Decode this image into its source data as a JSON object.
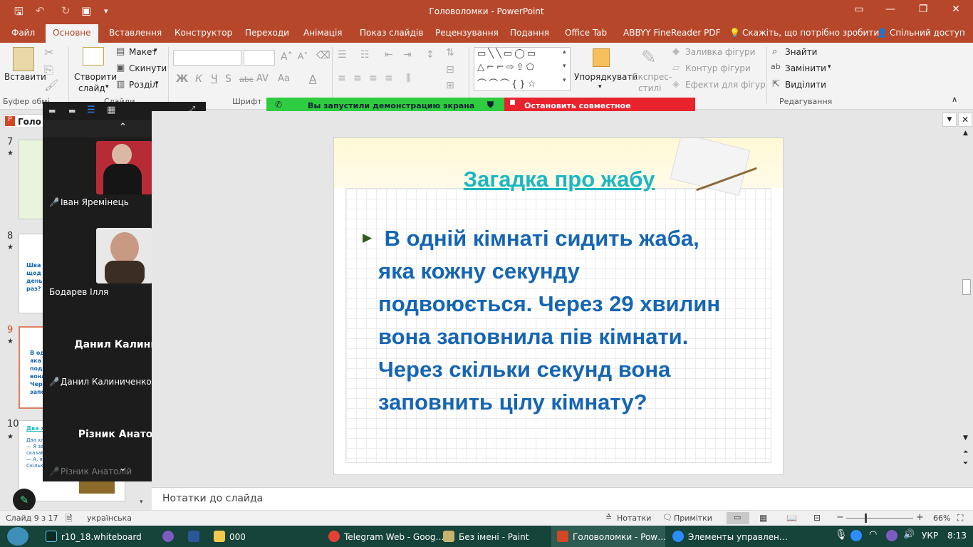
{
  "window": {
    "title": "Головоломки - PowerPoint"
  },
  "tabs": [
    "Файл",
    "Основне",
    "Вставлення",
    "Конструктор",
    "Переходи",
    "Анімація",
    "Показ слайдів",
    "Рецензування",
    "Подання",
    "Office Tab",
    "ABBYY FineReader PDF"
  ],
  "tell_me": "Скажіть, що потрібно зробити",
  "share": "Спільний доступ",
  "ribbon": {
    "paste": "Вставити",
    "new_slide_line1": "Створити",
    "new_slide_line2": "слайд",
    "layout": "Макет",
    "reset": "Скинути",
    "section": "Розділ",
    "clipboard_group": "Буфер обмі…",
    "slides_group": "Слайди",
    "font_group": "Шрифт",
    "arrange": "Упорядкувати",
    "express_line1": "Експрес-",
    "express_line2": "стилі",
    "shape_fill": "Заливка фігури",
    "shape_outline": "Контур фігури",
    "shape_effects": "Ефекти для фігур",
    "find": "Знайти",
    "replace": "Замінити",
    "select": "Виділити",
    "editing_group": "Редагування"
  },
  "screen_share": {
    "notice": "Вы запустили демонстрацию экрана",
    "stop": "Остановить совместное использование"
  },
  "thumbnails": [
    {
      "num": "7"
    },
    {
      "num": "8",
      "lines": [
        "Шва",
        "щод",
        "день",
        "раз?"
      ]
    },
    {
      "num": "9",
      "lines": [
        "В од",
        "яка",
        "поді",
        "вона",
        "Черє",
        "запо"
      ]
    },
    {
      "num": "10",
      "title": "Два х",
      "lines": [
        "Два хлоп",
        "— Я зав",
        "сказав В",
        "— А, я -",
        "Скільки"
      ]
    }
  ],
  "left_tab_label": "Голо",
  "zoom_panel": {
    "participants": [
      {
        "name": "Іван Яремінець",
        "muted": true,
        "has_video": true
      },
      {
        "name": "Бодарев Ілля",
        "muted": false,
        "has_video": true
      },
      {
        "name": "Данил Калиниченко.",
        "display": "Данил  Калинич…",
        "muted": true,
        "has_video": false
      },
      {
        "name": "Різник Анатолій",
        "display": "Різник Анатолій",
        "muted": true,
        "has_video": false
      }
    ]
  },
  "slide": {
    "title": "Загадка про жабу",
    "body_lines": [
      " В одній кімнаті сидить жаба,",
      "яка кожну секунду",
      "подвоюється. Через 29 хвилин",
      "вона заповнила пів кімнати.",
      "Через скільки секунд вона",
      "заповнить цілу кімнату?"
    ],
    "title_color": "#1ab7c2",
    "text_color": "#1565b4"
  },
  "notes_placeholder": "Нотатки до слайда",
  "status": {
    "slide_of": "Слайд 9 з 17",
    "language": "українська",
    "notes": "Нотатки",
    "comments": "Примітки",
    "zoom": "66%"
  },
  "taskbar": {
    "apps": [
      "r10_18.whiteboard",
      "000",
      "Telegram Web - Goog…",
      "Без імені - Paint",
      "Головоломки - Pow…",
      "Элементы управлен…"
    ],
    "lang": "УКР",
    "time": "8:13"
  }
}
